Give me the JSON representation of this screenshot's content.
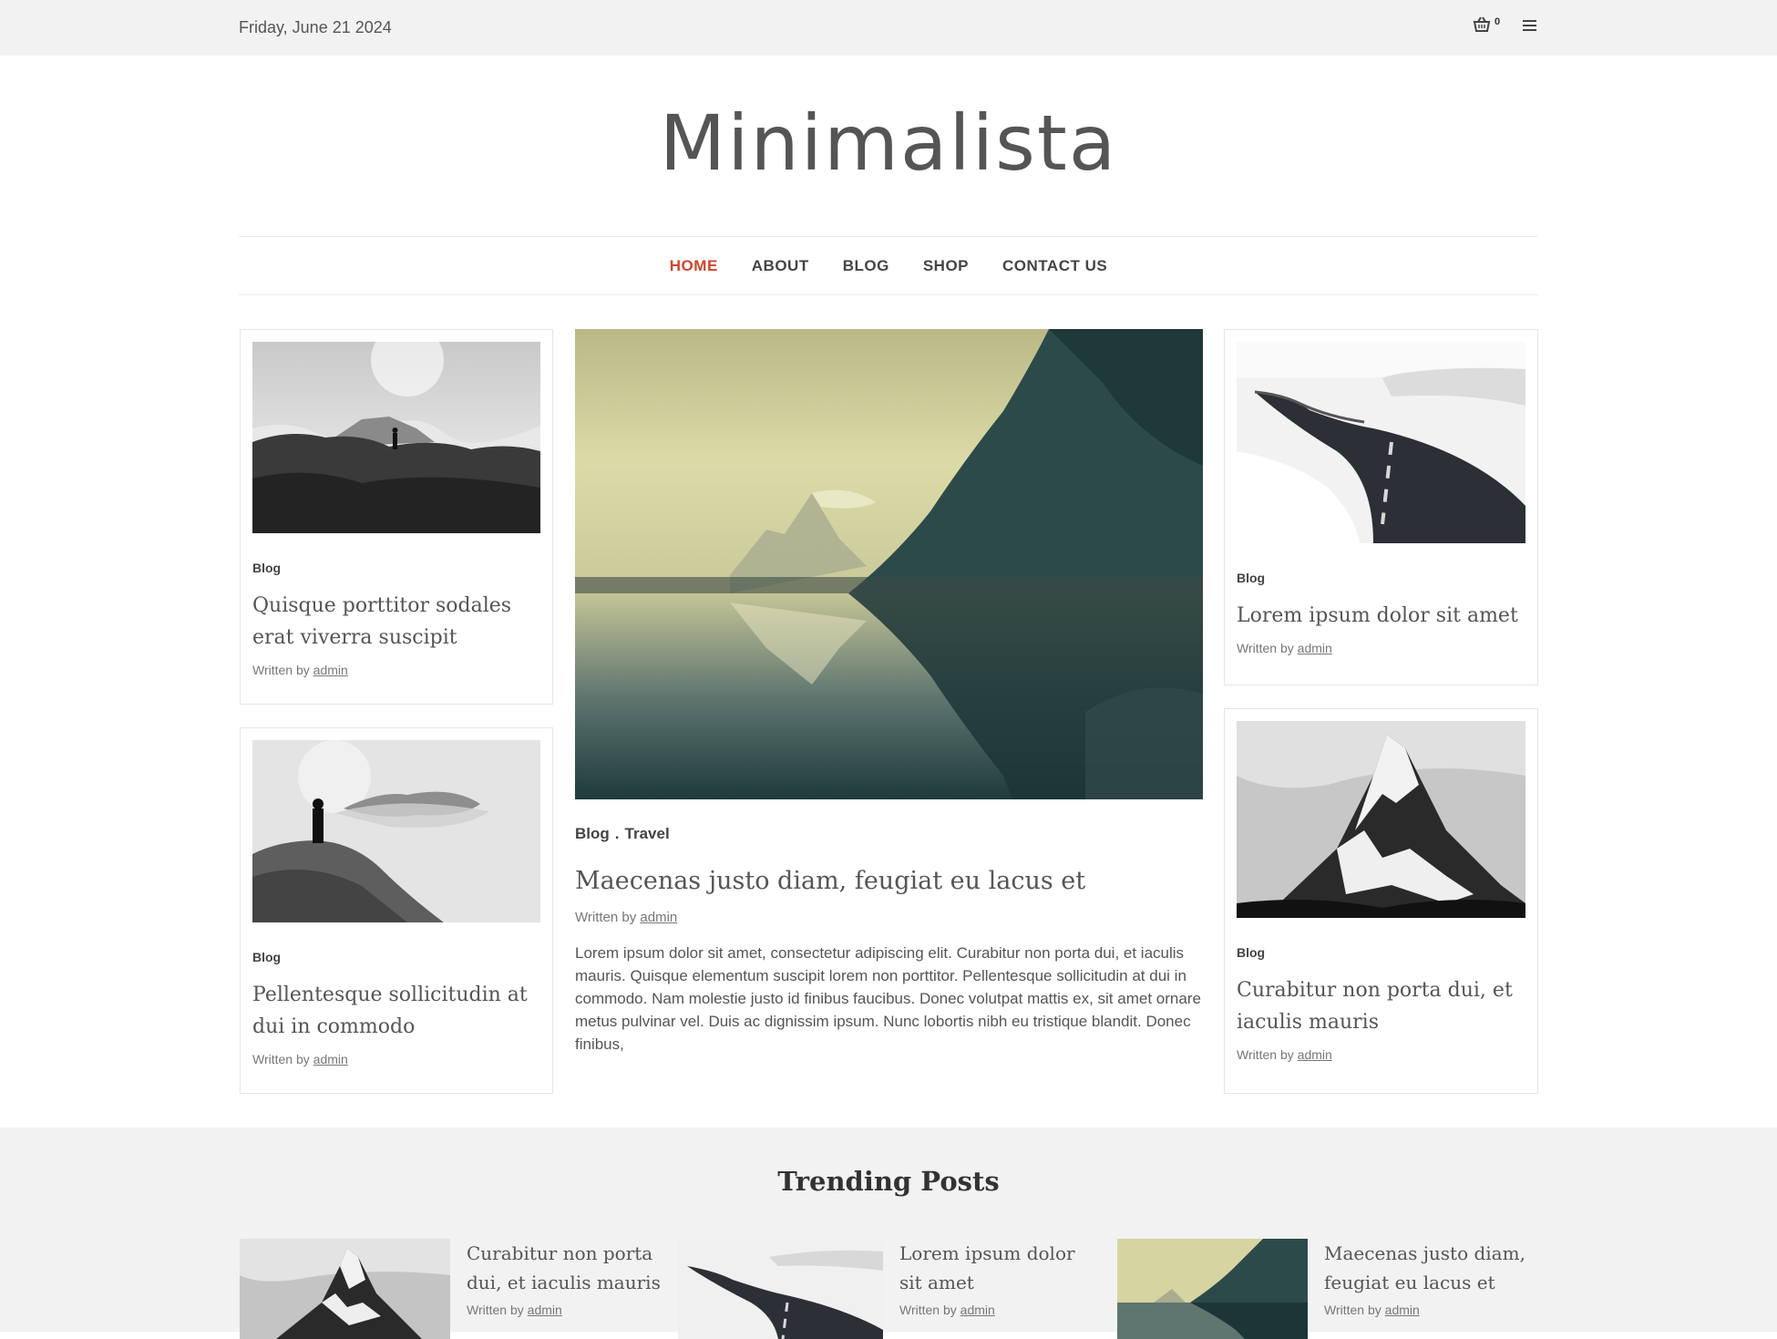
{
  "topbar": {
    "date": "Friday, June 21 2024",
    "cart_count": "0"
  },
  "site": {
    "title": "Minimalista"
  },
  "nav": {
    "items": [
      {
        "label": "HOME"
      },
      {
        "label": "ABOUT"
      },
      {
        "label": "BLOG"
      },
      {
        "label": "SHOP"
      },
      {
        "label": "CONTACT US"
      }
    ],
    "active": "HOME"
  },
  "posts": {
    "left_top": {
      "category": "Blog",
      "title": "Quisque porttitor sodales erat viverra suscipit",
      "written_by": "Written by",
      "author": "admin"
    },
    "left_bottom": {
      "category": "Blog",
      "title": "Pellentesque sollicitudin at dui in commodo",
      "written_by": "Written by",
      "author": "admin"
    },
    "featured": {
      "category_1": "Blog",
      "separator": ".",
      "category_2": "Travel",
      "title": "Maecenas justo diam, feugiat eu lacus et",
      "written_by": "Written by",
      "author": "admin",
      "excerpt": "Lorem ipsum dolor sit amet, consectetur adipiscing elit. Curabitur non porta dui, et iaculis mauris. Quisque elementum suscipit lorem non porttitor. Pellentesque sollicitudin at dui in commodo. Nam molestie justo id finibus faucibus. Donec volutpat mattis ex, sit amet ornare metus pulvinar vel. Duis ac dignissim ipsum. Nunc lobortis nibh eu tristique blandit. Donec finibus,"
    },
    "right_top": {
      "category": "Blog",
      "title": "Lorem ipsum dolor sit amet",
      "written_by": "Written by",
      "author": "admin"
    },
    "right_bottom": {
      "category": "Blog",
      "title": "Curabitur non porta dui, et iaculis mauris",
      "written_by": "Written by",
      "author": "admin"
    }
  },
  "trending": {
    "heading": "Trending Posts",
    "items": [
      {
        "title": "Curabitur non porta dui, et iaculis mauris",
        "written_by": "Written by",
        "author": "admin"
      },
      {
        "title": "Lorem ipsum dolor sit amet",
        "written_by": "Written by",
        "author": "admin"
      },
      {
        "title": "Maecenas justo diam, feugiat eu lacus et",
        "written_by": "Written by",
        "author": "admin"
      }
    ]
  },
  "colors": {
    "accent": "#d0442c",
    "topbar_bg": "#f2f2f2",
    "text": "#555555"
  },
  "icons": {
    "cart": "basket-icon",
    "menu": "hamburger-menu-icon"
  }
}
